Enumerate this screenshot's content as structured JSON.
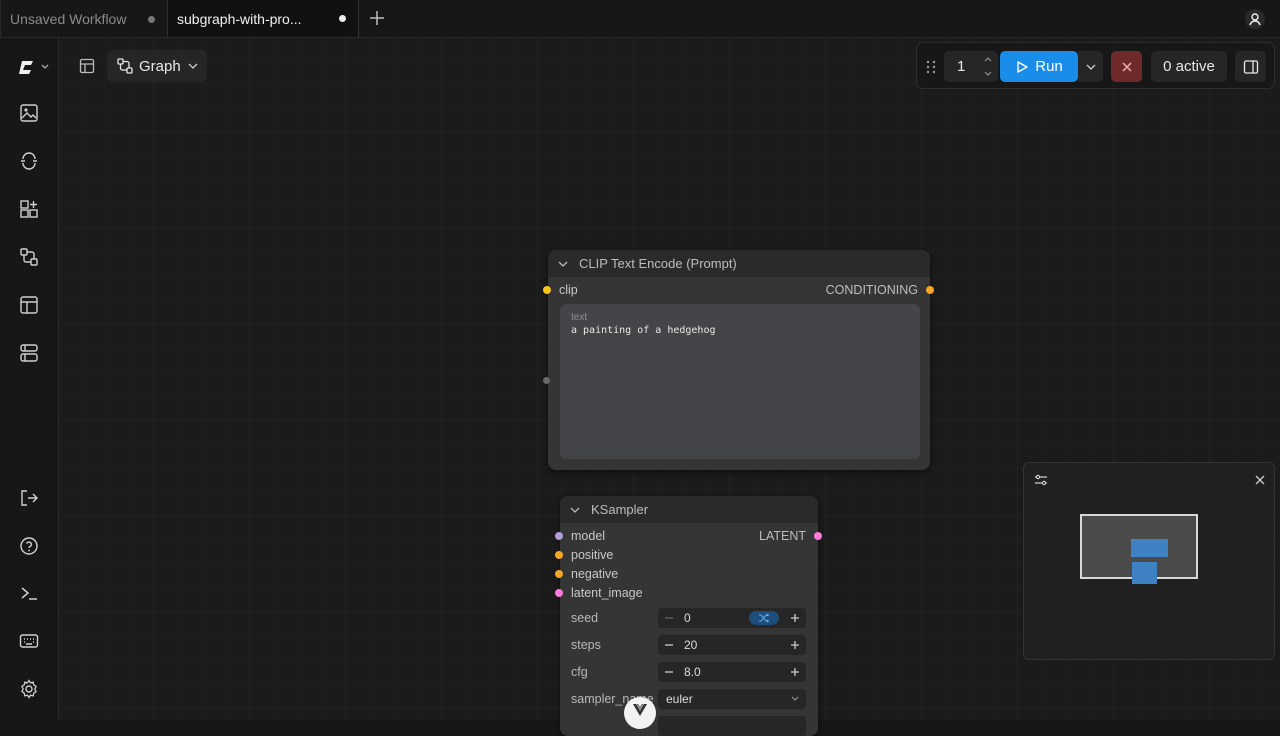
{
  "tabs": [
    {
      "label": "Unsaved Workflow",
      "active": false
    },
    {
      "label": "subgraph-with-pro...",
      "active": true
    }
  ],
  "toolbar": {
    "view_label": "Graph",
    "batch_count": "1",
    "run_label": "Run",
    "active_label": "0 active"
  },
  "sidebar": {
    "items": [
      "comfy-logo",
      "images-icon",
      "models-icon",
      "nodes-icon",
      "workflows-icon",
      "templates-icon",
      "queue-icon"
    ],
    "bottom_items": [
      "logout-icon",
      "help-icon",
      "terminal-icon",
      "keyboard-icon",
      "settings-icon"
    ]
  },
  "nodes": {
    "clip_text_encode": {
      "title": "CLIP Text Encode (Prompt)",
      "input_clip": "clip",
      "output_conditioning": "CONDITIONING",
      "text_label": "text",
      "text_value": "a painting of a hedgehog"
    },
    "ksampler": {
      "title": "KSampler",
      "inputs": [
        "model",
        "positive",
        "negative",
        "latent_image"
      ],
      "output_latent": "LATENT",
      "widgets": [
        {
          "label": "seed",
          "value": "0"
        },
        {
          "label": "steps",
          "value": "20"
        },
        {
          "label": "cfg",
          "value": "8.0"
        },
        {
          "label": "sampler_name",
          "value": "euler"
        }
      ]
    }
  },
  "colors": {
    "accent_blue": "#1a8cea",
    "stop_red": "#6e2a2a",
    "clip_slot": "#f5c518",
    "conditioning_slot": "#f5a623",
    "model_slot": "#b39ddb",
    "latent_slot": "#ff7ad9"
  }
}
